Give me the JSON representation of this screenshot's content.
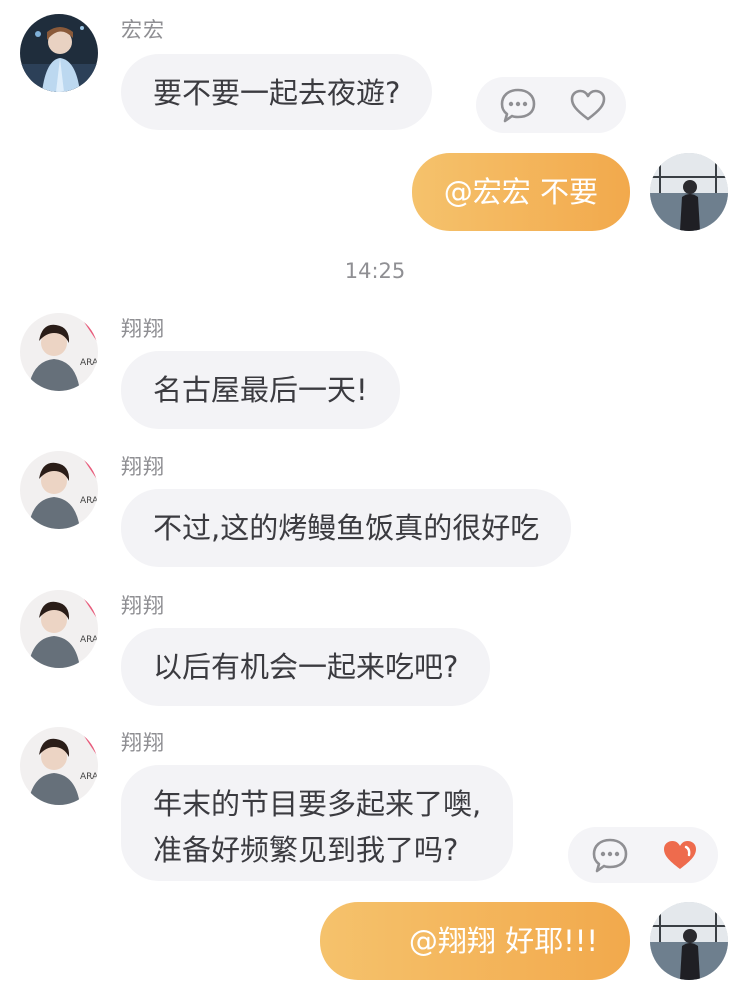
{
  "colors": {
    "bubble_in": "#f3f3f6",
    "bubble_out_start": "#f5c26c",
    "bubble_out_end": "#f2a94c",
    "like_active": "#ee6b4d",
    "meta_text": "#8f8f93"
  },
  "timestamp": "14:25",
  "messages": [
    {
      "sender": "宏宏",
      "text": "要不要一起去夜遊?",
      "direction": "incoming",
      "reactions": {
        "comment_icon": "comment-icon",
        "like_icon": "heart-icon",
        "liked": false
      }
    },
    {
      "sender": "",
      "text": "@宏宏 不要",
      "direction": "outgoing"
    },
    {
      "sender": "翔翔",
      "text": "名古屋最后一天!",
      "direction": "incoming"
    },
    {
      "sender": "翔翔",
      "text": "不过,这的烤鳗鱼饭真的很好吃",
      "direction": "incoming"
    },
    {
      "sender": "翔翔",
      "text": "以后有机会一起来吃吧?",
      "direction": "incoming"
    },
    {
      "sender": "翔翔",
      "lines": [
        "年末的节目要多起来了噢,",
        "准备好频繁见到我了吗?"
      ],
      "direction": "incoming",
      "reactions": {
        "comment_icon": "comment-icon",
        "like_icon": "heart-icon",
        "liked": true
      }
    },
    {
      "sender": "",
      "text": "@翔翔 好耶!!!",
      "direction": "outgoing"
    }
  ]
}
